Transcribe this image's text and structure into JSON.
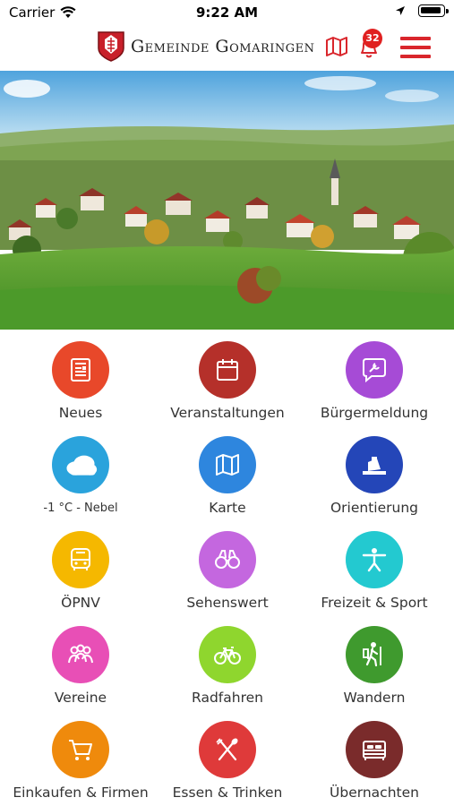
{
  "status_bar": {
    "carrier": "Carrier",
    "time": "9:22 AM"
  },
  "header": {
    "title": "Gemeinde Gomaringen",
    "notification_count": "32"
  },
  "colors": {
    "brand_red": "#d9262c",
    "badge_red": "#e02020"
  },
  "tiles": [
    {
      "label": "Neues",
      "color": "#e8482a",
      "icon": "newspaper-icon"
    },
    {
      "label": "Veranstaltungen",
      "color": "#b5302a",
      "icon": "calendar-icon"
    },
    {
      "label": "Bürgermeldung",
      "color": "#a64bd6",
      "icon": "wrench-chat-icon"
    },
    {
      "label": "-1 °C - Nebel",
      "color": "#2aa3dc",
      "icon": "cloud-icon"
    },
    {
      "label": "Karte",
      "color": "#2e86de",
      "icon": "map-icon"
    },
    {
      "label": "Orientierung",
      "color": "#2446b8",
      "icon": "sign-icon"
    },
    {
      "label": "ÖPNV",
      "color": "#f5b800",
      "icon": "bus-icon"
    },
    {
      "label": "Sehenswert",
      "color": "#c467df",
      "icon": "binoculars-icon"
    },
    {
      "label": "Freizeit & Sport",
      "color": "#23c9d0",
      "icon": "person-sport-icon"
    },
    {
      "label": "Vereine",
      "color": "#e84fb6",
      "icon": "group-icon"
    },
    {
      "label": "Radfahren",
      "color": "#8fd62e",
      "icon": "bicycle-icon"
    },
    {
      "label": "Wandern",
      "color": "#3f9a2e",
      "icon": "hiker-icon"
    },
    {
      "label": "Einkaufen & Firmen",
      "color": "#ef8a0c",
      "icon": "cart-icon"
    },
    {
      "label": "Essen & Trinken",
      "color": "#df3a3a",
      "icon": "cutlery-icon"
    },
    {
      "label": "Übernachten",
      "color": "#7a2b2b",
      "icon": "bed-icon"
    }
  ]
}
